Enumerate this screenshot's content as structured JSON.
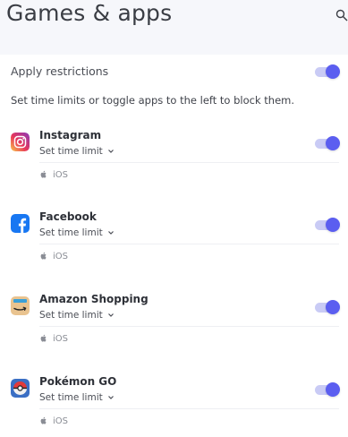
{
  "header": {
    "title": "Games & apps"
  },
  "restrictions": {
    "label": "Apply restrictions",
    "enabled": true,
    "hint": "Set time limits or toggle apps to the left to block them."
  },
  "apps": [
    {
      "name": "Instagram",
      "limit_label": "Set time limit",
      "platform": "iOS",
      "enabled": true,
      "icon": "instagram-icon"
    },
    {
      "name": "Facebook",
      "limit_label": "Set time limit",
      "platform": "iOS",
      "enabled": true,
      "icon": "facebook-icon"
    },
    {
      "name": "Amazon Shopping",
      "limit_label": "Set time limit",
      "platform": "iOS",
      "enabled": true,
      "icon": "amazon-shopping-icon"
    },
    {
      "name": "Pokémon GO",
      "limit_label": "Set time limit",
      "platform": "iOS",
      "enabled": true,
      "icon": "pokemon-go-icon"
    }
  ],
  "colors": {
    "accent": "#5b5ef0",
    "accent_track": "#c9cbf5",
    "page_bg": "#f6f7fb",
    "card_bg": "#ffffff"
  }
}
